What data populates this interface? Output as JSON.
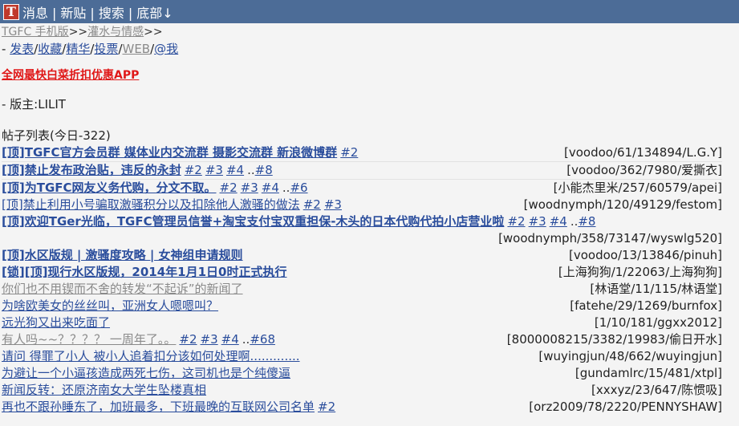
{
  "header": {
    "logo": "T",
    "nav": [
      "消息",
      "新贴",
      "搜索",
      "底部↓"
    ]
  },
  "breadcrumb": {
    "site": "TGFC 手机版",
    "arrow1": ">>",
    "forum": "灌水与情感",
    "arrow2": ">>"
  },
  "links": {
    "prefix": "- ",
    "items": [
      "发表",
      "收藏",
      "精华",
      "投票",
      "WEB",
      "@我"
    ]
  },
  "promo": "全网最快白菜折扣优惠APP",
  "moderator": "- 版主:LILIT",
  "list_title": "帖子列表(今日-322)",
  "threads": [
    {
      "title": "[顶]TGFC官方会员群 媒体业内交流群 摄影交流群 新浪微博群",
      "style": "bold",
      "pages": [
        "#2"
      ],
      "meta": "[voodoo/61/134894/L.G.Y]"
    },
    {
      "title": "[顶]禁止发布政治贴，违反的永封",
      "style": "bold",
      "pages": [
        "#2",
        "#3",
        "#4"
      ],
      "last": "..#8",
      "meta": "[voodoo/362/7980/爱撕衣]"
    },
    {
      "title": "[顶]为TGFC网友义务代购，分文不取。",
      "style": "bold",
      "pages": [
        "#2",
        "#3",
        "#4"
      ],
      "last": "..#6",
      "meta": "[小能杰里米/257/60579/apei]"
    },
    {
      "title": "[顶]禁止利用小号骗取激骚积分以及扣除他人激骚的做法",
      "style": "normal",
      "pages": [
        "#2",
        "#3"
      ],
      "meta": "[woodnymph/120/49129/festom]"
    },
    {
      "title": "[顶]欢迎TGer光临，TGFC管理员信誉+淘宝支付宝双重担保-木头的日本代购代拍小店营业啦",
      "style": "bold",
      "pages": [
        "#2",
        "#3",
        "#4"
      ],
      "last": "..#8",
      "meta": "[woodnymph/358/73147/wyswlg520]",
      "wrap": true
    },
    {
      "title": "[顶]水区版规 | 激骚度攻略 | 女神组申请规则",
      "style": "bold",
      "pages": [],
      "meta": "[voodoo/13/13846/pinuh]"
    },
    {
      "title": "[锁][顶]现行水区版规，2014年1月1日0时正式执行",
      "style": "bold",
      "pages": [],
      "meta": "[上海狗狗/1/22063/上海狗狗]"
    },
    {
      "title": "你们也不用锲而不舍的转发“不起诉”的新闻了",
      "style": "grey",
      "pages": [],
      "meta": "[林语堂/11/115/林语堂]"
    },
    {
      "title": "为啥欧美女的丝丝叫，亚洲女人嗯嗯叫？",
      "style": "normal",
      "pages": [],
      "meta": "[fatehe/29/1269/burnfox]"
    },
    {
      "title": "远光狗又出来吃面了",
      "style": "normal",
      "pages": [],
      "meta": "[1/10/181/ggxx2012]"
    },
    {
      "title": "有人吗~~？？？？ 一周年了。。",
      "style": "grey",
      "pages": [
        "#2",
        "#3",
        "#4"
      ],
      "last": "..#68",
      "meta": "[8000008215/3382/19983/偷日开水]"
    },
    {
      "title": "请问 得罪了小人 被小人追着扣分该如何处理啊.............",
      "style": "normal",
      "pages": [],
      "meta": "[wuyingjun/48/662/wuyingjun]"
    },
    {
      "title": "为避让一个小逼孩造成两死七伤，这司机也是个纯傻逼",
      "style": "normal",
      "pages": [],
      "meta": "[gundamlrc/15/481/xtpl]"
    },
    {
      "title": "新闻反转：还原济南女大学生坠楼真相",
      "style": "normal",
      "pages": [],
      "meta": "[xxxyz/23/647/陈惯吸]"
    },
    {
      "title": "再也不跟孙睡东了，加班最多，下班最晚的互联网公司名单",
      "style": "normal",
      "pages": [
        "#2"
      ],
      "meta": "[orz2009/78/2220/PENNYSHAW]"
    }
  ]
}
